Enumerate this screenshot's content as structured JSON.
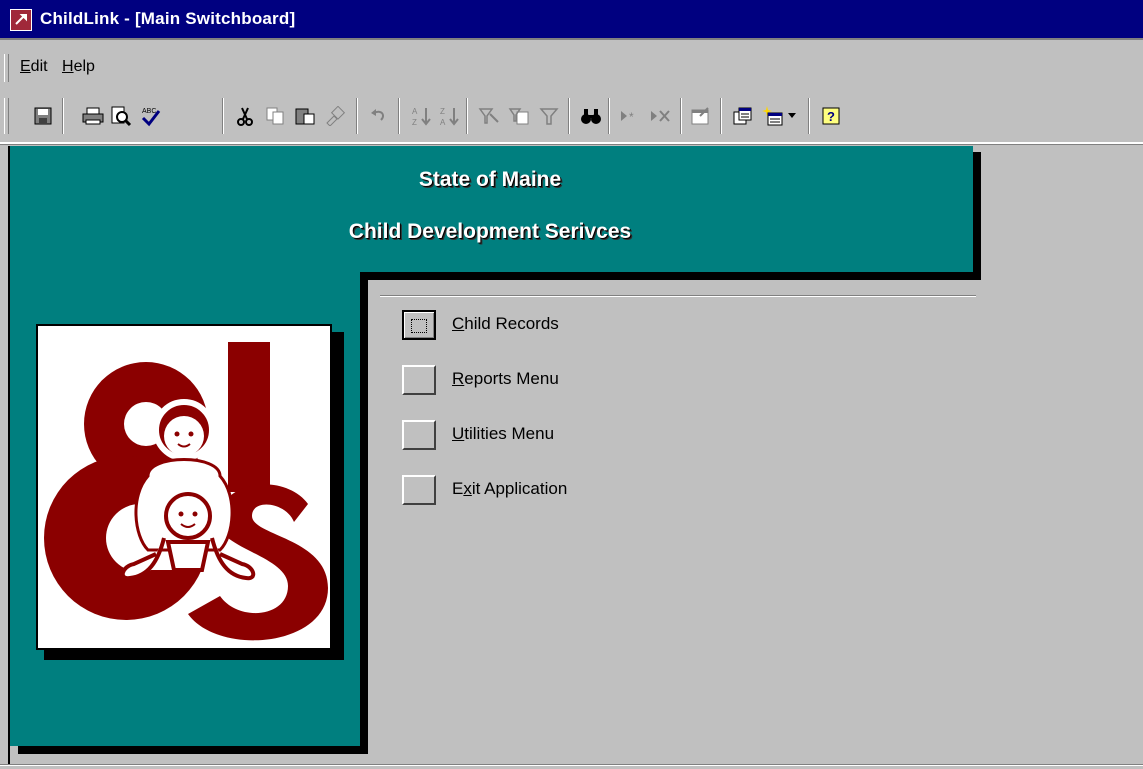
{
  "window": {
    "title": "ChildLink - [Main Switchboard]",
    "app_icon": "access-key-icon"
  },
  "menubar": {
    "items": [
      {
        "label": "Edit",
        "accel": "E",
        "rest": "dit"
      },
      {
        "label": "Help",
        "accel": "H",
        "rest": "elp"
      }
    ]
  },
  "toolbar": {
    "buttons": [
      "save-icon",
      "print-icon",
      "print-preview-icon",
      "spelling-icon",
      "cut-icon",
      "copy-icon",
      "paste-icon",
      "format-painter-icon",
      "undo-icon",
      "sort-ascending-icon",
      "sort-descending-icon",
      "filter-by-selection-icon",
      "filter-by-form-icon",
      "apply-filter-icon",
      "find-icon",
      "new-record-icon",
      "delete-record-icon",
      "properties-icon",
      "database-window-icon",
      "new-object-icon",
      "help-icon"
    ]
  },
  "form": {
    "heading1": "State of Maine",
    "heading2": "Child Development Serivces",
    "colors": {
      "panel": "#007f7f",
      "logo": "#8b0000",
      "background": "#c0c0c0"
    },
    "logo": {
      "letters": "cds"
    },
    "switchboard_items": [
      {
        "accel": "C",
        "rest": "hild Records",
        "label": "Child Records"
      },
      {
        "accel": "R",
        "rest": "eports Menu",
        "label": "Reports Menu"
      },
      {
        "accel": "U",
        "rest": "tilities Menu",
        "label": "Utilities Menu"
      },
      {
        "pre": "E",
        "accel": "x",
        "rest": "it Application",
        "label": "Exit Application"
      }
    ]
  }
}
